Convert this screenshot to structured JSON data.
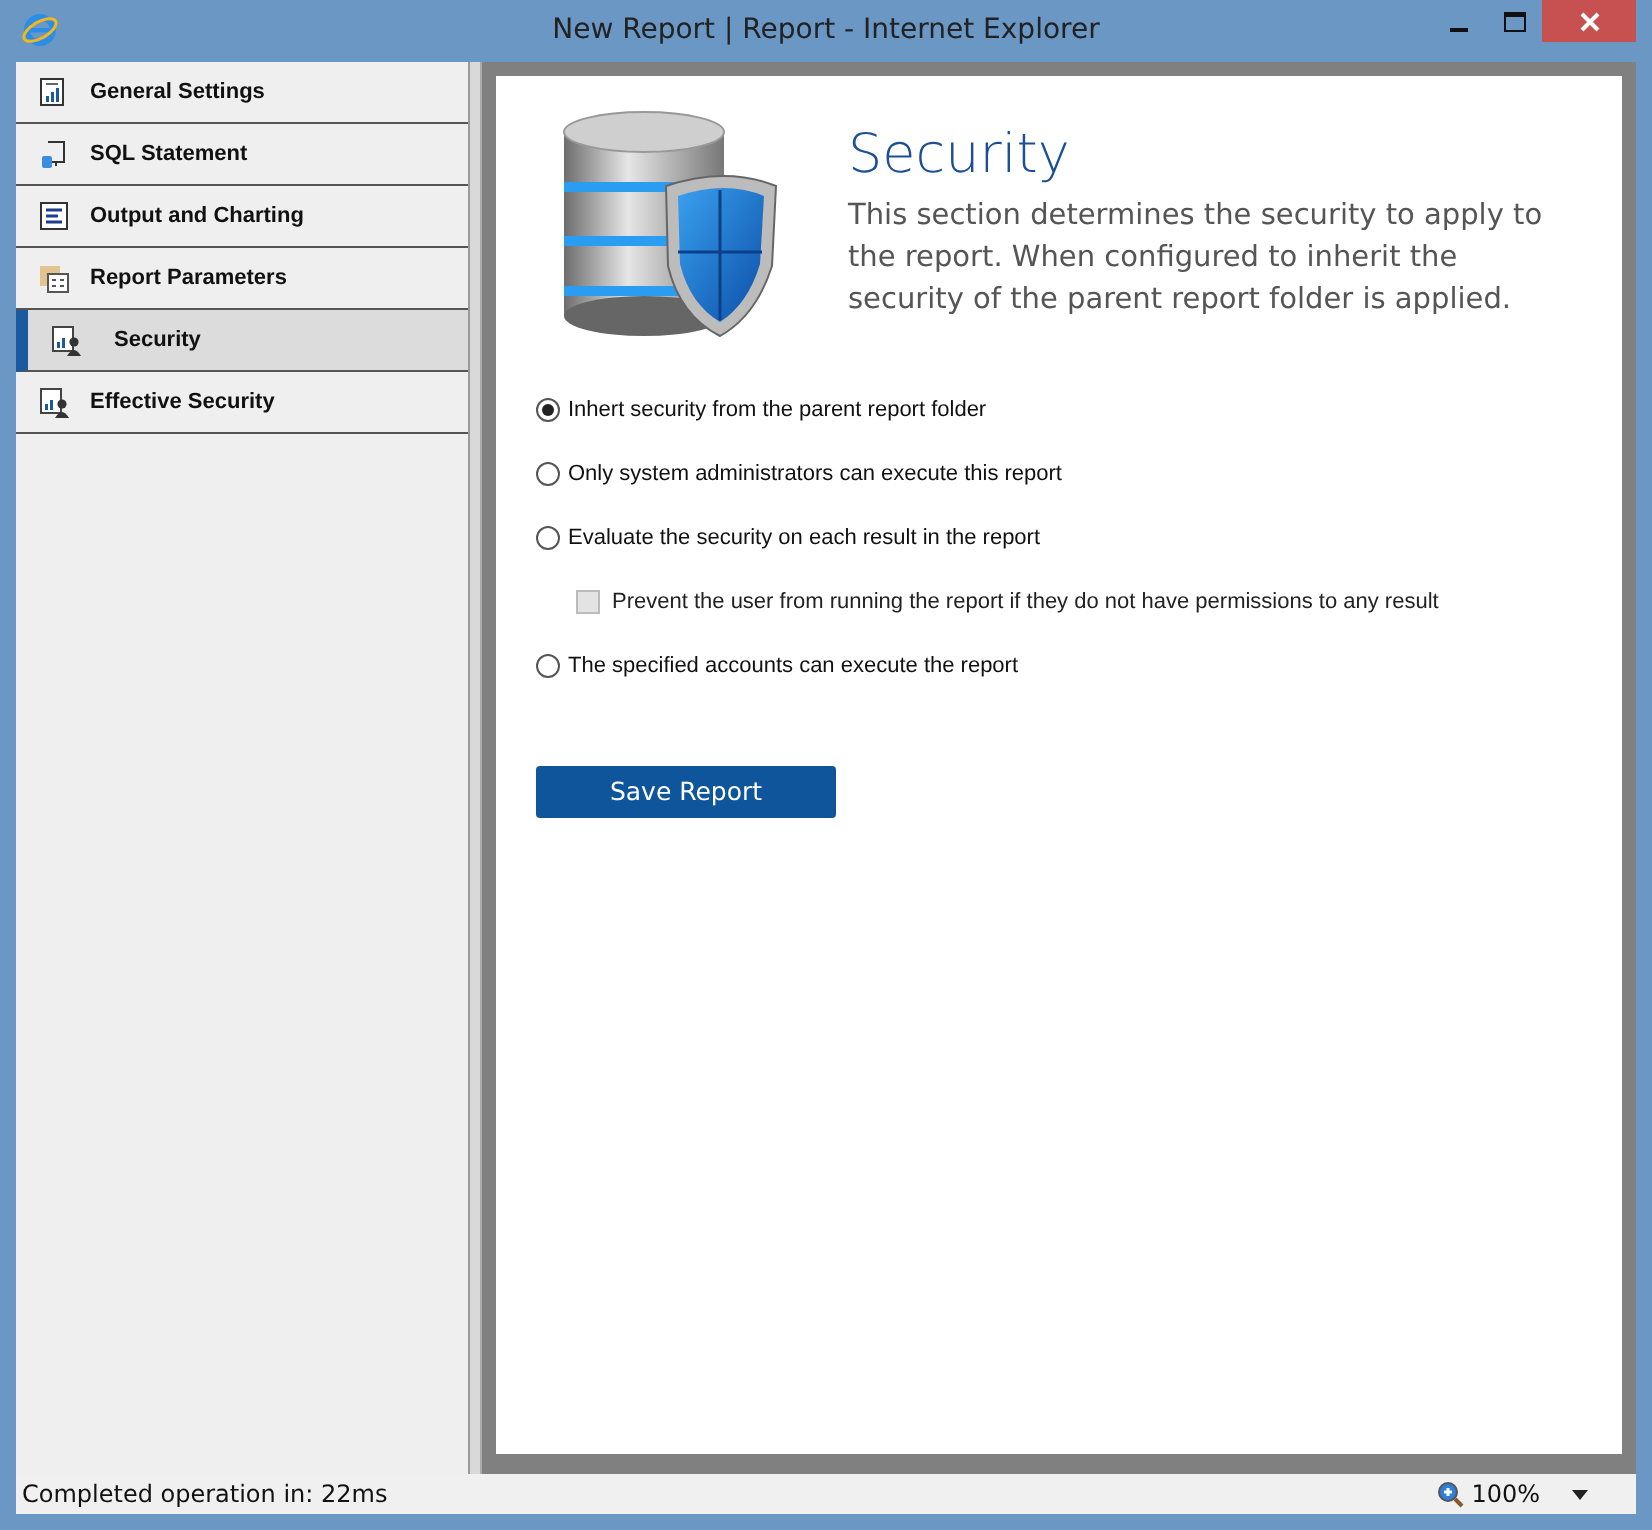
{
  "window": {
    "title": "New Report | Report - Internet Explorer"
  },
  "sidebar": {
    "items": [
      {
        "label": "General Settings",
        "kind": "chart",
        "selected": false
      },
      {
        "label": "SQL Statement",
        "kind": "sql",
        "selected": false
      },
      {
        "label": "Output and Charting",
        "kind": "output",
        "selected": false
      },
      {
        "label": "Report Parameters",
        "kind": "params",
        "selected": false
      },
      {
        "label": "Security",
        "kind": "user",
        "selected": true
      },
      {
        "label": "Effective Security",
        "kind": "user",
        "selected": false
      }
    ]
  },
  "section": {
    "title": "Security",
    "description": "This section determines the security to apply to the report. When configured to inherit the security of the parent report folder is applied."
  },
  "options": [
    {
      "kind": "radio",
      "label": "Inhert security from the parent report folder",
      "selected": true
    },
    {
      "kind": "radio",
      "label": "Only system administrators can execute this report",
      "selected": false
    },
    {
      "kind": "radio",
      "label": "Evaluate the security on each result in the report",
      "selected": false
    },
    {
      "kind": "checkbox",
      "label": "Prevent the user from running the report if they do not have permissions to any result",
      "checked": false,
      "disabled": true
    },
    {
      "kind": "radio",
      "label": "The specified accounts can execute the report",
      "selected": false
    }
  ],
  "save_button": "Save Report",
  "status_bar": {
    "text": "Completed operation in: 22ms",
    "zoom": "100%"
  }
}
